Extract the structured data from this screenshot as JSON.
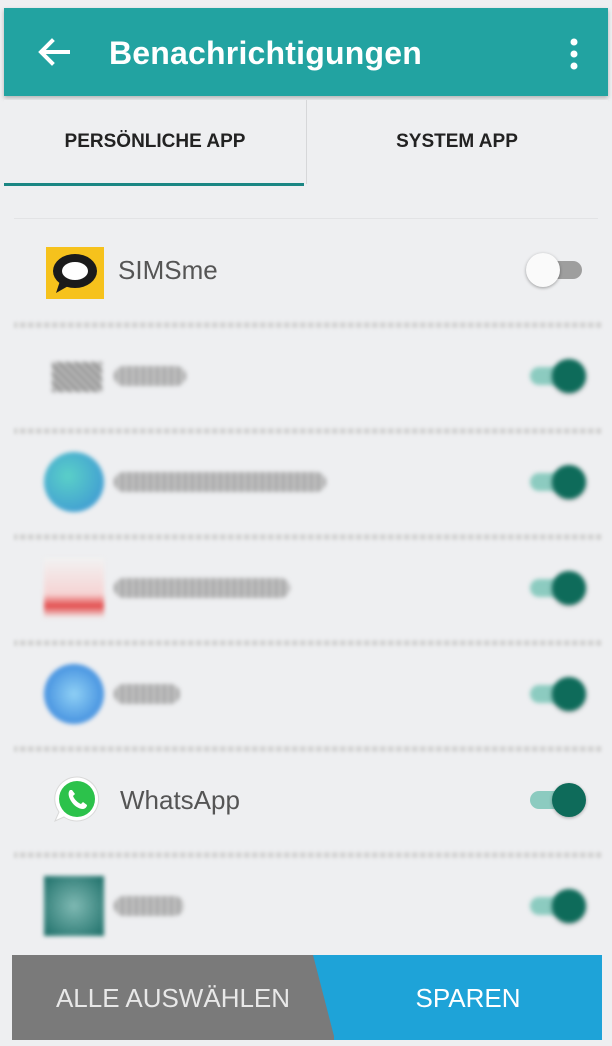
{
  "appbar": {
    "title": "Benachrichtigungen",
    "back_icon": "arrow-left-icon",
    "menu_icon": "more-vert-icon"
  },
  "tabs": [
    {
      "label": "PERSÖNLICHE APP",
      "selected": true
    },
    {
      "label": "SYSTEM APP",
      "selected": false
    }
  ],
  "apps": [
    {
      "name": "SIMSme",
      "icon": "simsme-icon",
      "enabled": false
    },
    {
      "name": "",
      "icon": "blurred-app-icon",
      "enabled": true
    },
    {
      "name": "",
      "icon": "blurred-app-icon",
      "enabled": true
    },
    {
      "name": "",
      "icon": "blurred-app-icon",
      "enabled": true
    },
    {
      "name": "",
      "icon": "blurred-app-icon",
      "enabled": true
    },
    {
      "name": "WhatsApp",
      "icon": "whatsapp-icon",
      "enabled": true
    },
    {
      "name": "",
      "icon": "blurred-app-icon",
      "enabled": true
    }
  ],
  "bottom": {
    "select_all": "ALLE AUSWÄHLEN",
    "save": "SPAREN"
  },
  "colors": {
    "appbar": "#22a3a1",
    "toggle_on": "#0e6b5a",
    "save_button": "#1ea3d8",
    "select_button": "#7a7a7a"
  }
}
